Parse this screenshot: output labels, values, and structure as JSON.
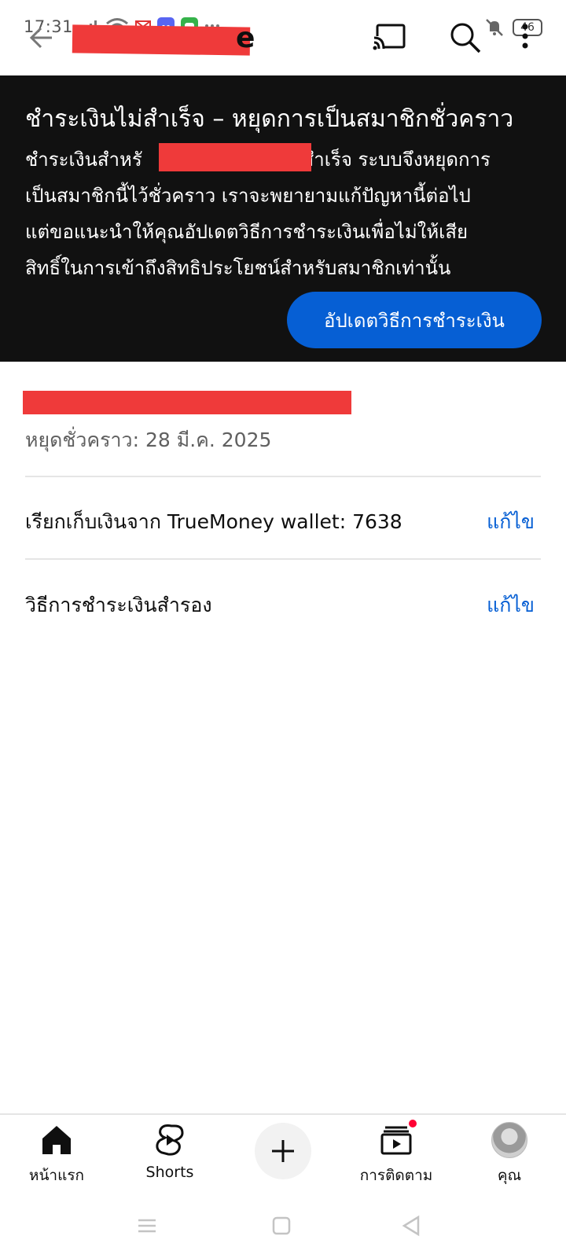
{
  "status_bar": {
    "time": "17:31",
    "battery": "46"
  },
  "app_bar": {
    "title_visible_tail": "e",
    "icons": [
      "back-arrow-icon",
      "cast-icon",
      "search-icon",
      "more-vert-icon"
    ]
  },
  "banner": {
    "title": "ชำระเงินไม่สำเร็จ – หยุดการเป็นสมาชิกชั่วคราว",
    "body_line1_start": "ชำระเงินสำหรั",
    "body_line1_end": "ไม่สำเร็จ ระบบจึงหยุดการ",
    "body_line2": "เป็นสมาชิกนี้ไว้ชั่วคราว เราจะพยายามแก้ปัญหานี้ต่อไป",
    "body_line3": "แต่ขอแนะนำให้คุณอัปเดตวิธีการชำระเงินเพื่อไม่ให้เสีย",
    "body_line4": "สิทธิ์ในการเข้าถึงสิทธิประโยชน์สำหรับสมาชิกเท่านั้น",
    "button_label": "อัปเดตวิธีการชำระเงิน"
  },
  "membership": {
    "paused_text": "หยุดชั่วคราว: 28 มี.ค. 2025",
    "rows": [
      {
        "label": "เรียกเก็บเงินจาก TrueMoney wallet: 7638",
        "action": "แก้ไข"
      },
      {
        "label": "วิธีการชำระเงินสำรอง",
        "action": "แก้ไข"
      }
    ]
  },
  "bottom_nav": {
    "items": [
      {
        "label": "หน้าแรก",
        "icon": "home-icon"
      },
      {
        "label": "Shorts",
        "icon": "shorts-icon"
      },
      {
        "label": "",
        "icon": "plus-icon"
      },
      {
        "label": "การติดตาม",
        "icon": "subscriptions-icon"
      },
      {
        "label": "คุณ",
        "icon": "avatar"
      }
    ]
  },
  "colors": {
    "banner_bg": "#111111",
    "accent": "#065fd4",
    "redaction": "#ef3a3a",
    "notification": "#ff0033"
  }
}
